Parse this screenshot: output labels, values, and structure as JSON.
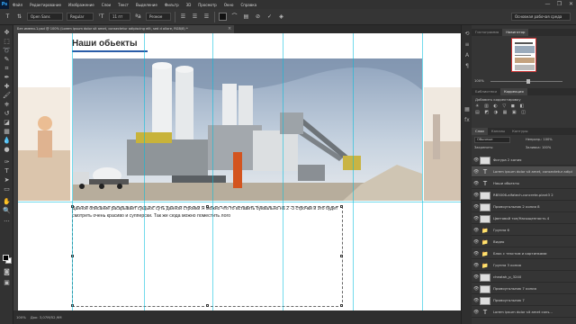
{
  "app": {
    "logo": "Ps"
  },
  "menu": [
    "Файл",
    "Редактирование",
    "Изображение",
    "Слои",
    "Текст",
    "Выделение",
    "Фильтр",
    "3D",
    "Просмотр",
    "Окно",
    "Справка"
  ],
  "window_controls": [
    "—",
    "❐",
    "✕"
  ],
  "options_bar": {
    "font_family": "Open Sans",
    "font_style": "Regular",
    "font_size": "11 пт",
    "antialias": "Резкое",
    "workspace": "Основная рабочая среда"
  },
  "document_tab": {
    "title": "Без имени-1.psd @ 100% (Lorem ipsum dolor sit amet, consectetur adipiscing elit, sed d ollore, RGB/8) *",
    "close": "×"
  },
  "canvas": {
    "heading": "Наши обьекты",
    "body_text": "Данное описание раскрывает сущьюс суть данной стройки Я можно что то вставить буквально на 2 -3 строчки и это будет смотреть очень красиво и супперски. Так же сюда можно поместить лого"
  },
  "status_bar": {
    "zoom": "100%",
    "doc": "Док: 3,07M/52,9M"
  },
  "navigator": {
    "tabs": [
      "Гистограмма",
      "Навигатор"
    ],
    "active": 1,
    "zoom": "100%"
  },
  "adjustments": {
    "tabs": [
      "Библиотеки",
      "Коррекция"
    ],
    "active": 1,
    "label": "Добавить корректировку"
  },
  "layers_panel": {
    "tabs": [
      "Слои",
      "Каналы",
      "Контуры"
    ],
    "active": 0,
    "blend_mode": "Обычные",
    "opacity": "Непрозр.: 100%",
    "lock": "Закрепить:",
    "fill": "Заливка: 100%",
    "layers": [
      {
        "name": "Фигура 2 копия",
        "kind": "shape"
      },
      {
        "name": "Lorem ipsum dolor sit amet, consectetur adipisci...",
        "kind": "text",
        "selected": true
      },
      {
        "name": "Наши обьекты",
        "kind": "text"
      },
      {
        "name": "RB5006-alfatech-concrete-plant3 2",
        "kind": "image"
      },
      {
        "name": "Прямоугольник 2 копия 8",
        "kind": "shape"
      },
      {
        "name": "Цветовой тон/Насыщенность 4",
        "kind": "shape"
      },
      {
        "name": "Группа 6",
        "kind": "folder"
      },
      {
        "name": "Видео",
        "kind": "folder"
      },
      {
        "name": "Блок с текстом и картинками",
        "kind": "folder"
      },
      {
        "name": "Группа 3 копия",
        "kind": "folder"
      },
      {
        "name": "cheatah_p_3240",
        "kind": "image"
      },
      {
        "name": "Прямоугольник 7 копия",
        "kind": "shape"
      },
      {
        "name": "Прямоугольник 7",
        "kind": "shape"
      },
      {
        "name": "Lorem ipsum dolor sit amet cons...",
        "kind": "text"
      }
    ]
  }
}
